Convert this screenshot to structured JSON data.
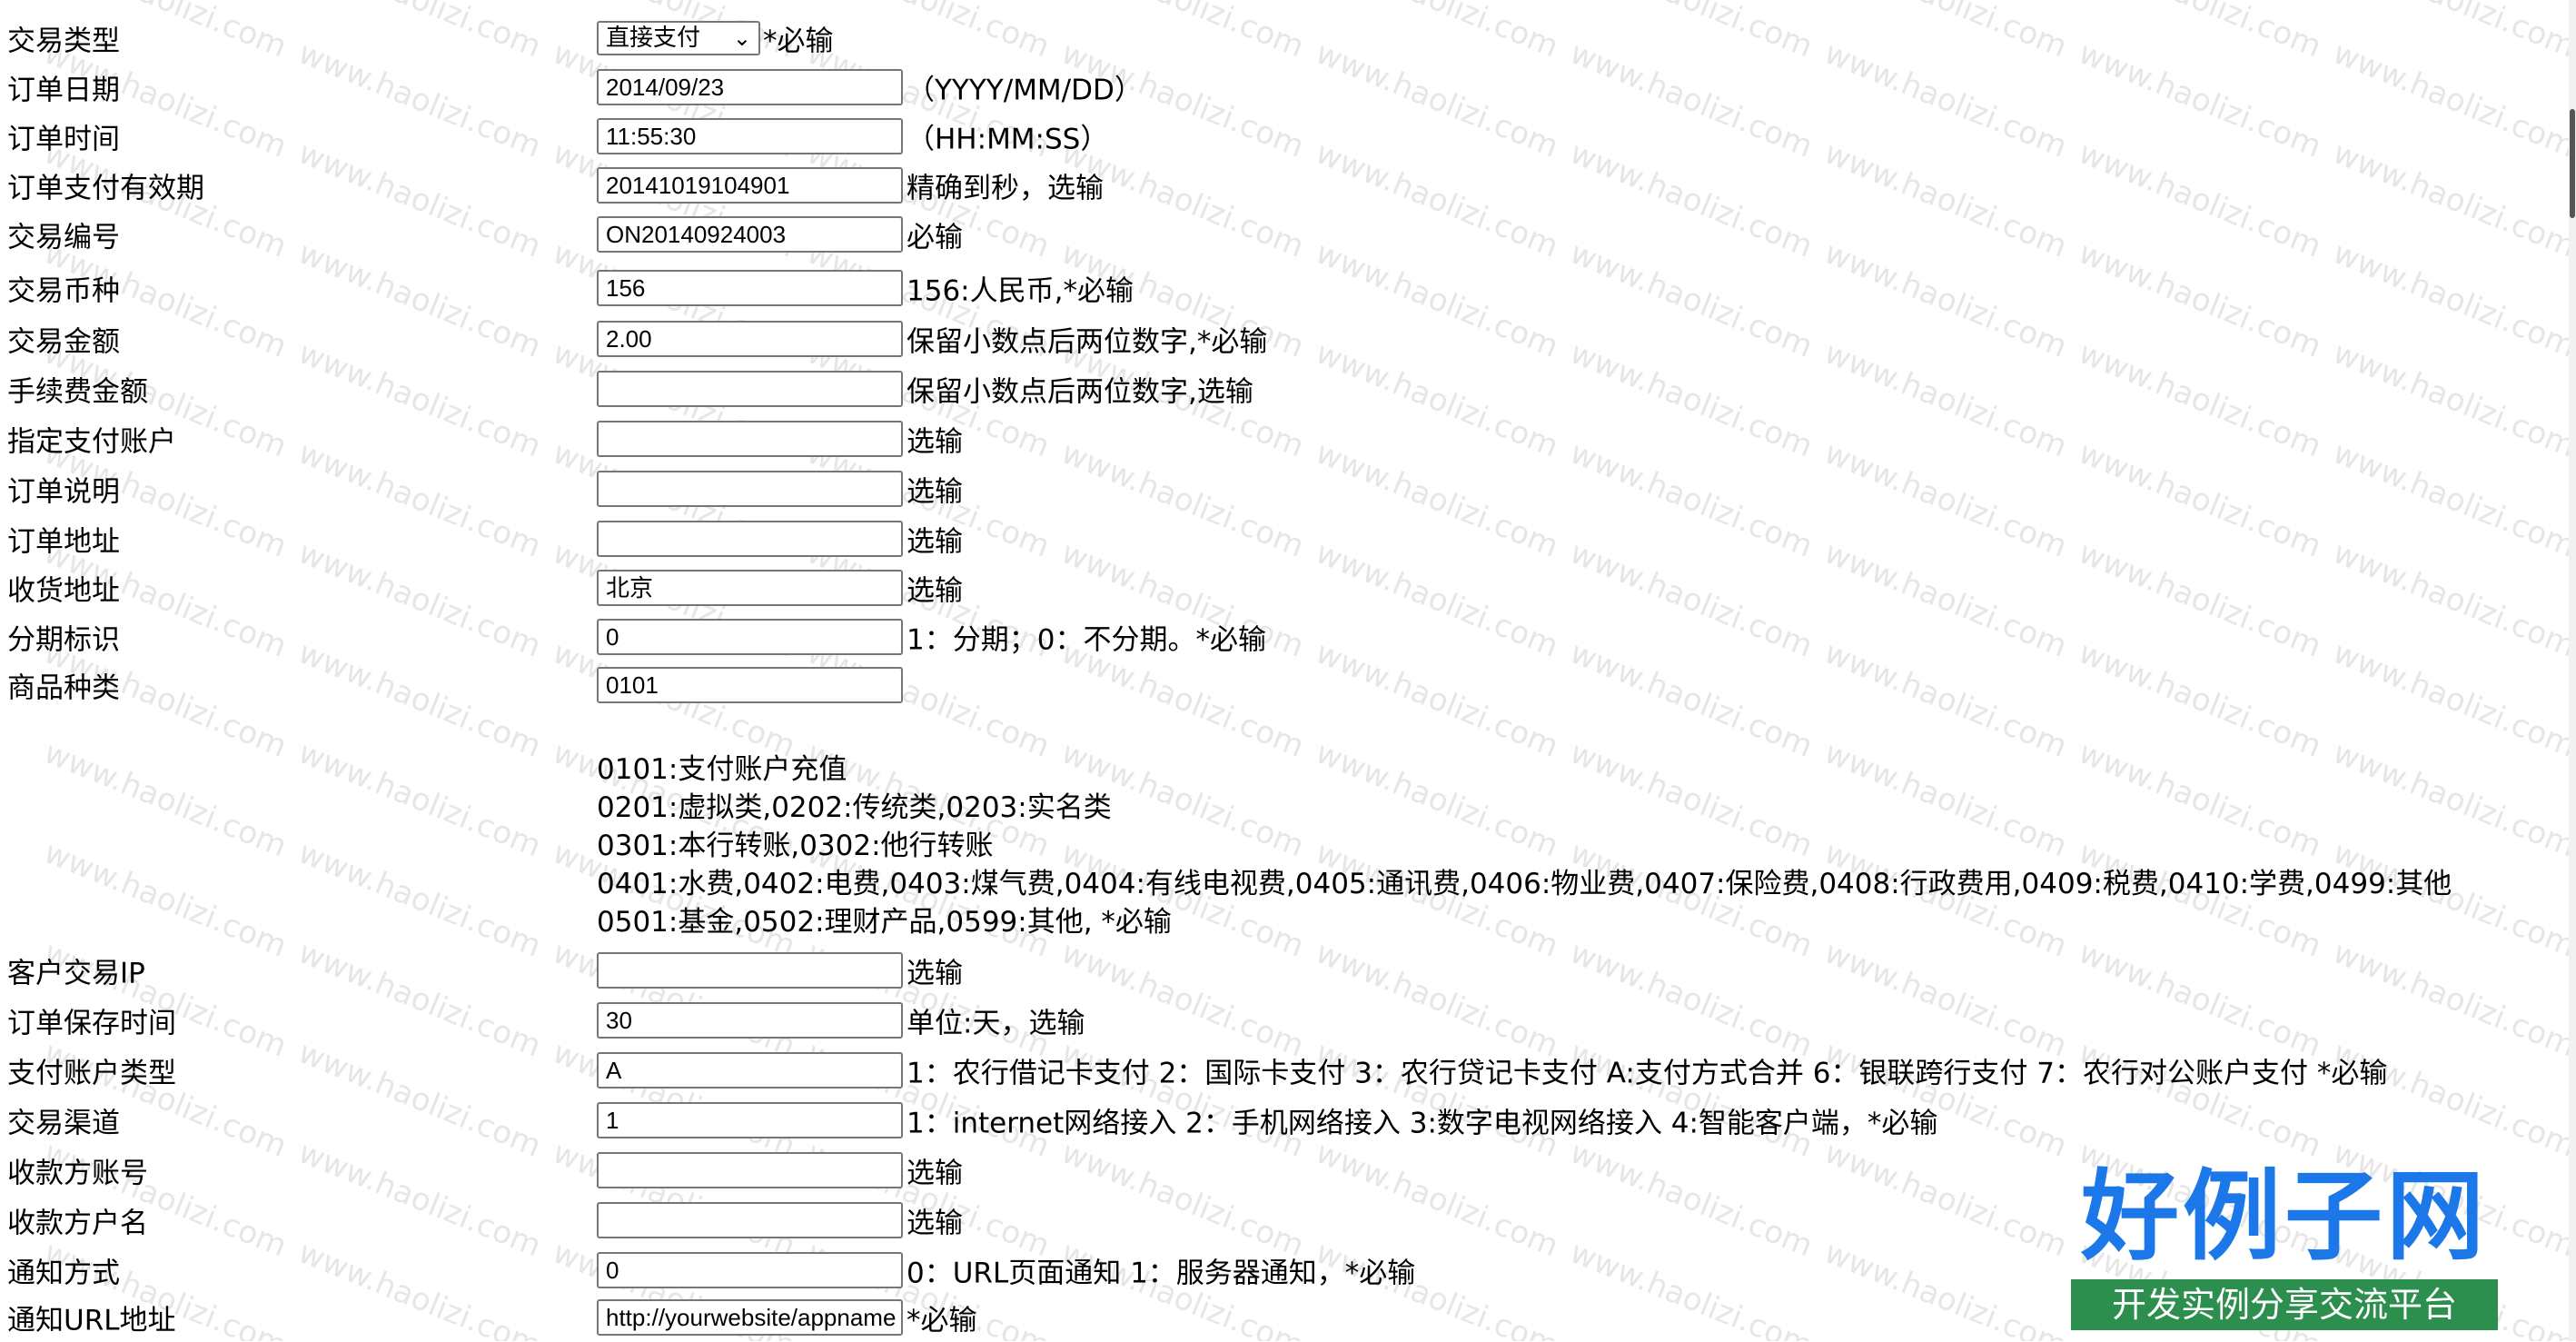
{
  "watermark_text": "www.haolizi.com",
  "fields": [
    {
      "label": "交易类型",
      "type": "select",
      "value": "直接支付",
      "hint": "*必输"
    },
    {
      "label": "订单日期",
      "type": "input",
      "value": "2014/09/23",
      "hint": "（YYYY/MM/DD）"
    },
    {
      "label": "订单时间",
      "type": "input",
      "value": "11:55:30",
      "hint": "（HH:MM:SS）"
    },
    {
      "label": "订单支付有效期",
      "type": "input",
      "value": "20141019104901",
      "hint": "精确到秒，选输"
    },
    {
      "label": "交易编号",
      "type": "input",
      "value": "ON20140924003",
      "hint": "必输"
    },
    {
      "label": "交易币种",
      "type": "input",
      "value": "156",
      "hint": "156:人民币,*必输"
    },
    {
      "label": "交易金额",
      "type": "input",
      "value": "2.00",
      "hint": "保留小数点后两位数字,*必输"
    },
    {
      "label": "手续费金额",
      "type": "input",
      "value": "",
      "hint": "保留小数点后两位数字,选输"
    },
    {
      "label": "指定支付账户",
      "type": "input",
      "value": "",
      "hint": "选输"
    },
    {
      "label": "订单说明",
      "type": "input",
      "value": "",
      "hint": "选输"
    },
    {
      "label": "订单地址",
      "type": "input",
      "value": "",
      "hint": "选输"
    },
    {
      "label": "收货地址",
      "type": "input",
      "value": "北京",
      "hint": "选输"
    },
    {
      "label": "分期标识",
      "type": "input",
      "value": "0",
      "hint": "1：分期；0：不分期。*必输"
    },
    {
      "label": "商品种类",
      "type": "input",
      "value": "0101",
      "hint": ""
    }
  ],
  "product_desc": [
    "0101:支付账户充值",
    "0201:虚拟类,0202:传统类,0203:实名类",
    "0301:本行转账,0302:他行转账",
    "0401:水费,0402:电费,0403:煤气费,0404:有线电视费,0405:通讯费,0406:物业费,0407:保险费,0408:行政费用,0409:税费,0410:学费,0499:其他",
    "0501:基金,0502:理财产品,0599:其他, *必输"
  ],
  "fields2": [
    {
      "label": "客户交易IP",
      "value": "",
      "hint": "选输"
    },
    {
      "label": "订单保存时间",
      "value": "30",
      "hint": "单位:天，选输"
    },
    {
      "label": "支付账户类型",
      "value": "A",
      "hint": "1：农行借记卡支付 2：国际卡支付 3：农行贷记卡支付 A:支付方式合并 6：银联跨行支付 7：农行对公账户支付 *必输"
    },
    {
      "label": "交易渠道",
      "value": "1",
      "hint": "1：internet网络接入 2：手机网络接入 3:数字电视网络接入 4:智能客户端，*必输"
    },
    {
      "label": "收款方账号",
      "value": "",
      "hint": "选输"
    },
    {
      "label": "收款方户名",
      "value": "",
      "hint": "选输"
    },
    {
      "label": "通知方式",
      "value": "0",
      "hint": "0：URL页面通知 1：服务器通知，*必输"
    },
    {
      "label": "通知URL地址",
      "value": "http://yourwebsite/appname",
      "hint": "*必输"
    }
  ],
  "brand": {
    "main": "好例子网",
    "sub": "开发实例分享交流平台"
  }
}
